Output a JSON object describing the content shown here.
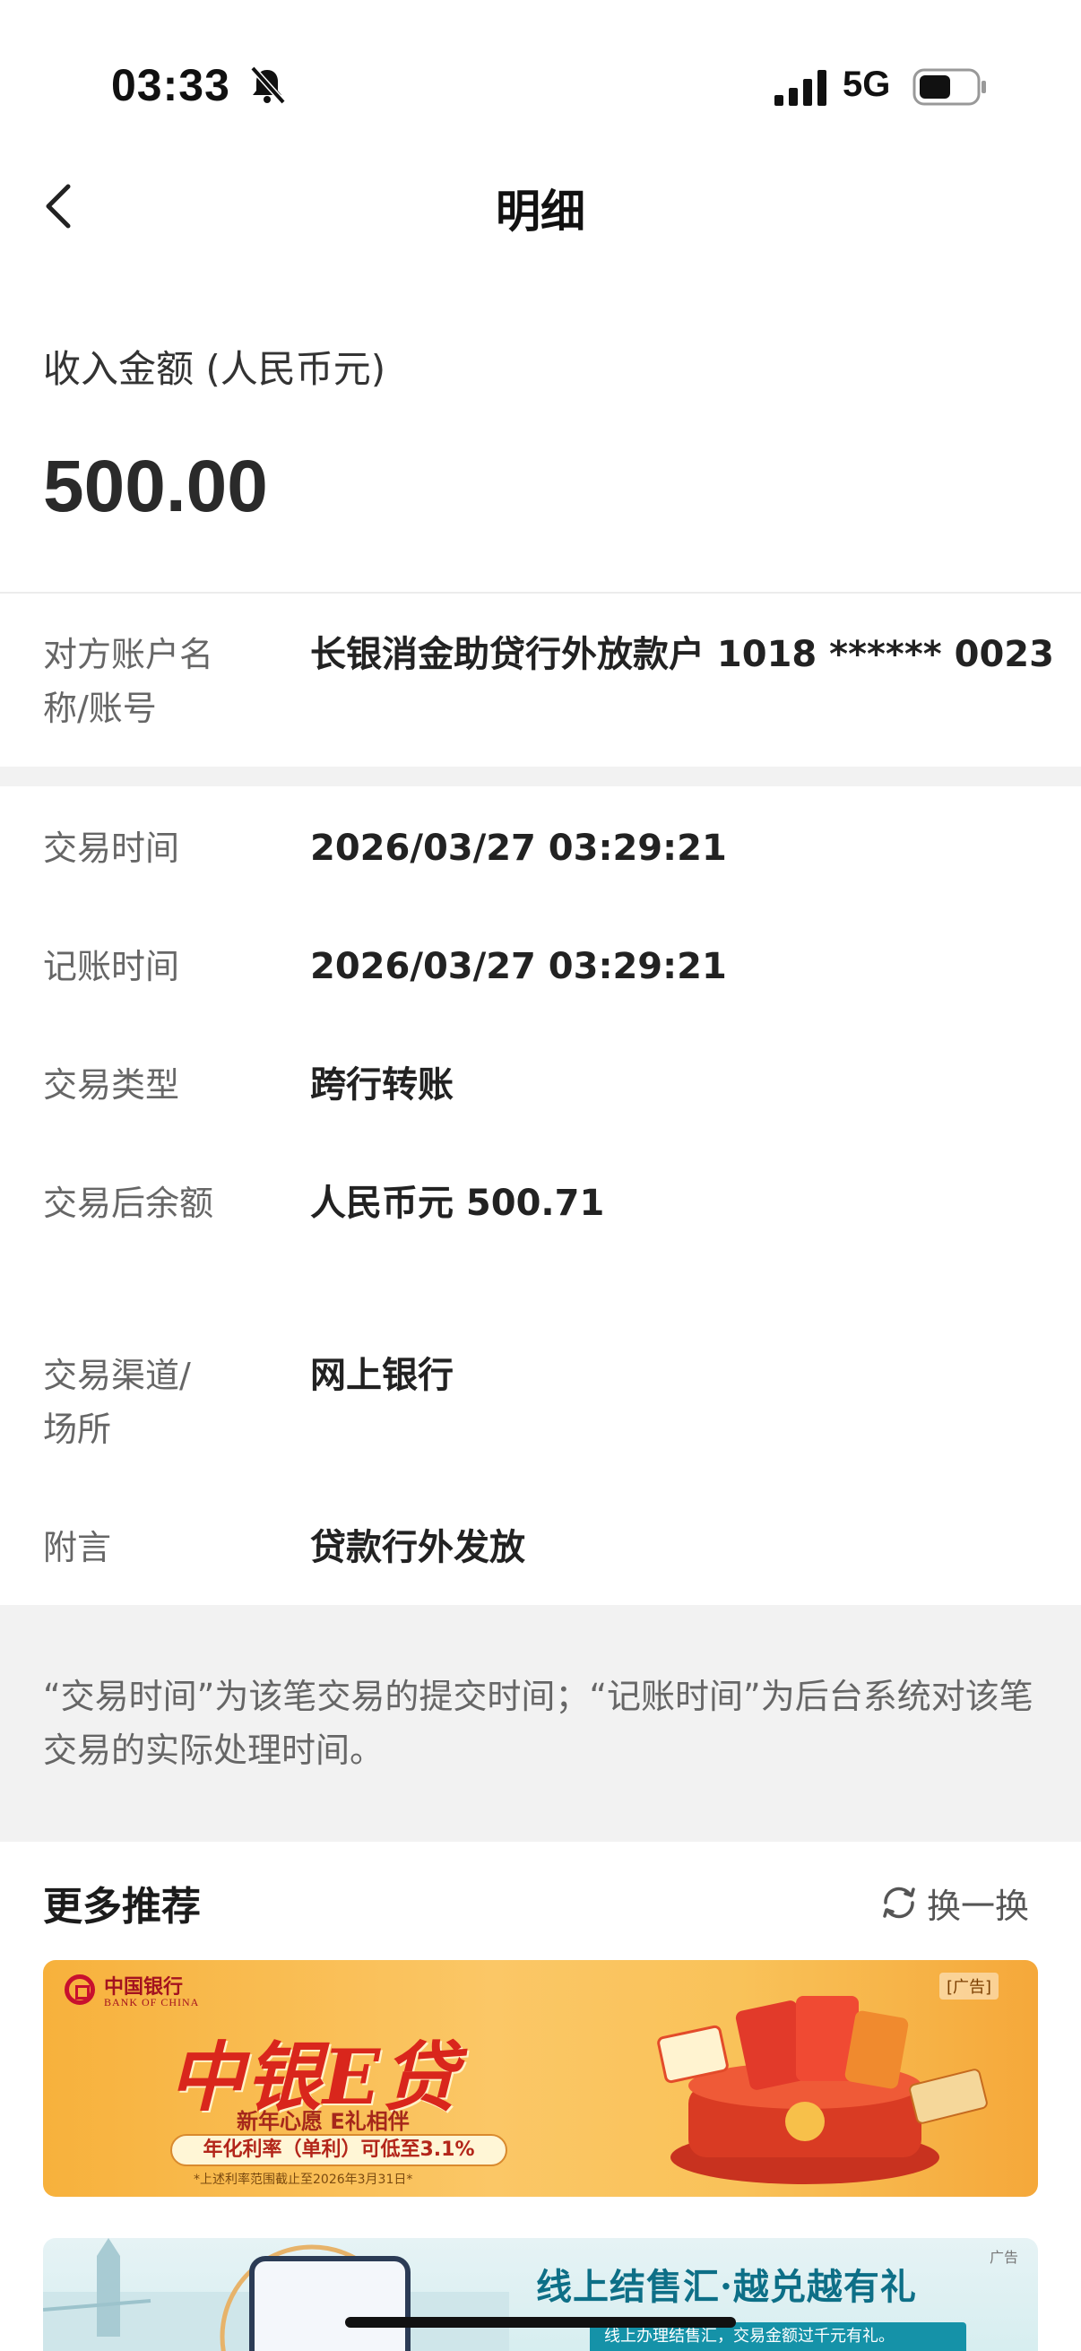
{
  "status_bar": {
    "time": "03:33",
    "network": "5G",
    "icons": [
      "bell-muted-icon",
      "signal-icon",
      "battery-icon"
    ]
  },
  "nav": {
    "title": "明细",
    "back_icon": "chevron-left-icon"
  },
  "amount": {
    "label": "收入金额 (人民币元)",
    "value": "500.00"
  },
  "counterparty": {
    "label": "对方账户名称/账号",
    "value": "长银消金助贷行外放款户 1018 ****** 0023"
  },
  "details": [
    {
      "label": "交易时间",
      "value": "2026/03/27 03:29:21"
    },
    {
      "label": "记账时间",
      "value": "2026/03/27 03:29:21"
    },
    {
      "label": "交易类型",
      "value": "跨行转账"
    },
    {
      "label": "交易后余额",
      "value": "人民币元 500.71"
    },
    {
      "label": "交易渠道/场所",
      "value": "网上银行"
    },
    {
      "label": "附言",
      "value": "贷款行外发放"
    }
  ],
  "note": "“交易时间”为该笔交易的提交时间；“记账时间”为后台系统对该笔交易的实际处理时间。",
  "recommend": {
    "title": "更多推荐",
    "refresh_label": "换一换",
    "refresh_icon": "refresh-icon"
  },
  "banner_1": {
    "bank_name": "中国银行",
    "bank_name_en": "BANK OF CHINA",
    "ad_tag": "[广告]",
    "title": "中银E贷",
    "subtitle": "新年心愿 E礼相伴",
    "rate_text": "年化利率（单利）可低至3.1%",
    "footnote": "*上述利率范围截止至2026年3月31日*",
    "colors": {
      "accent": "#d9261c",
      "background": "#fbc766"
    }
  },
  "banner_2": {
    "ad_tag": "广告",
    "title": "线上结售汇·越兑越有礼",
    "subtitle": "线上办理结售汇，交易金额过千元有礼。"
  }
}
